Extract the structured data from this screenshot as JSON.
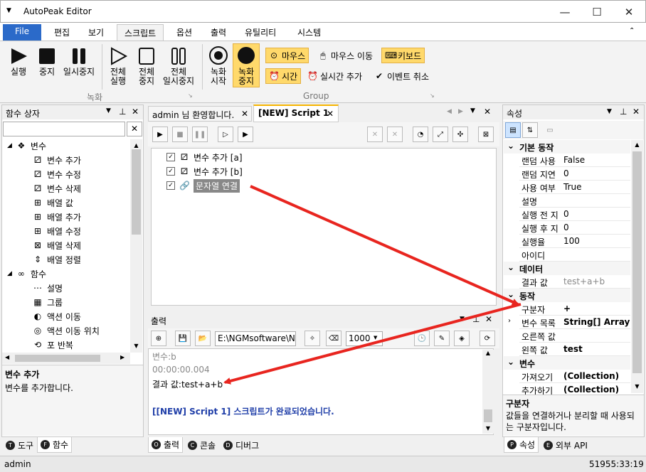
{
  "app": {
    "title": "AutoPeak Editor"
  },
  "ribbon_tabs": [
    "File",
    "편집",
    "보기",
    "스크립트",
    "옵션",
    "출력",
    "유틸리티",
    "시스템"
  ],
  "ribbon": {
    "record": [
      "실행",
      "중지",
      "일시중지"
    ],
    "all": [
      [
        "전체",
        "실행"
      ],
      [
        "전체",
        "중지"
      ],
      [
        "전체",
        "일시중지"
      ]
    ],
    "rec_start": [
      "녹화",
      "시작"
    ],
    "rec_stop": [
      "녹화",
      "중지"
    ],
    "group_record_label": "녹화",
    "group_label": "Group",
    "mouse": "마우스",
    "mouse_move": "마우스 이동",
    "keyboard": "키보드",
    "time": "시간",
    "realtime_add": "실시간 추가",
    "event_cancel": "이벤트 취소"
  },
  "left_panel": {
    "title": "함수 상자",
    "search_placeholder": "",
    "tree": [
      {
        "label": "변수",
        "level": 0,
        "icon": "variable-icon"
      },
      {
        "label": "변수 추가",
        "level": 1
      },
      {
        "label": "변수 수정",
        "level": 1
      },
      {
        "label": "변수 삭제",
        "level": 1
      },
      {
        "label": "배열 값",
        "level": 1
      },
      {
        "label": "배열 추가",
        "level": 1
      },
      {
        "label": "배열 수정",
        "level": 1
      },
      {
        "label": "배열 삭제",
        "level": 1
      },
      {
        "label": "배열 정렬",
        "level": 1
      },
      {
        "label": "함수",
        "level": 0
      },
      {
        "label": "설명",
        "level": 1
      },
      {
        "label": "그룹",
        "level": 1
      },
      {
        "label": "액션 이동",
        "level": 1
      },
      {
        "label": "액션 이동 위치",
        "level": 1
      },
      {
        "label": "포 반복",
        "level": 1
      }
    ],
    "desc_title": "변수 추가",
    "desc_text": "변수를 추가합니다.",
    "tabs": [
      "도구",
      "함수"
    ],
    "tab_letters": [
      "T",
      "F"
    ]
  },
  "doc_tabs": [
    {
      "label": "admin 님 환영합니다."
    },
    {
      "label": "[NEW] Script 1"
    }
  ],
  "script_items": [
    {
      "label": "변수 추가 [a]"
    },
    {
      "label": "변수 추가 [b]"
    },
    {
      "label": "문자열 연결"
    }
  ],
  "output": {
    "title": "출력",
    "path": "E:\\NGMsoftware\\NG",
    "delay": "1000",
    "lines": [
      "변수:b",
      "00:00:00.004",
      "결과 값:test+a+b",
      "",
      "[[NEW] Script 1] 스크립트가 완료되었습니다."
    ],
    "tabs": [
      "출력",
      "콘솔",
      "디버그"
    ],
    "tab_letters": [
      "O",
      "C",
      "D"
    ]
  },
  "properties": {
    "title": "속성",
    "categories": [
      {
        "name": "기본 동작",
        "rows": [
          [
            "랜덤 사용",
            "False"
          ],
          [
            "랜덤 지연",
            "0"
          ],
          [
            "사용 여부",
            "True"
          ],
          [
            "설명",
            ""
          ],
          [
            "실행 전 지",
            "0"
          ],
          [
            "실행 후 지",
            "0"
          ],
          [
            "실행율",
            "100"
          ],
          [
            "아이디",
            ""
          ]
        ]
      },
      {
        "name": "데이터",
        "rows": [
          [
            "결과 값",
            "test+a+b"
          ]
        ]
      },
      {
        "name": "동작",
        "rows": [
          [
            "구분자",
            "+"
          ],
          [
            "변수 목록",
            "String[] Array"
          ],
          [
            "오른쪽 값",
            ""
          ],
          [
            "왼쪽 값",
            "test"
          ]
        ]
      },
      {
        "name": "변수",
        "rows": [
          [
            "가져오기",
            "(Collection)"
          ],
          [
            "추가하기",
            "(Collection)"
          ]
        ]
      }
    ],
    "desc_title": "구분자",
    "desc_text": "값들을 연결하거나 분리할 때 사용되는 구분자입니다.",
    "tabs": [
      "속성",
      "외부 API"
    ],
    "tab_letters": [
      "P",
      "E"
    ]
  },
  "status": {
    "user": "admin",
    "time": "51955:33:19"
  },
  "colors": {
    "accent": "#2b6ac9",
    "highlight": "#ffd96b",
    "arrow": "#e8251f"
  }
}
